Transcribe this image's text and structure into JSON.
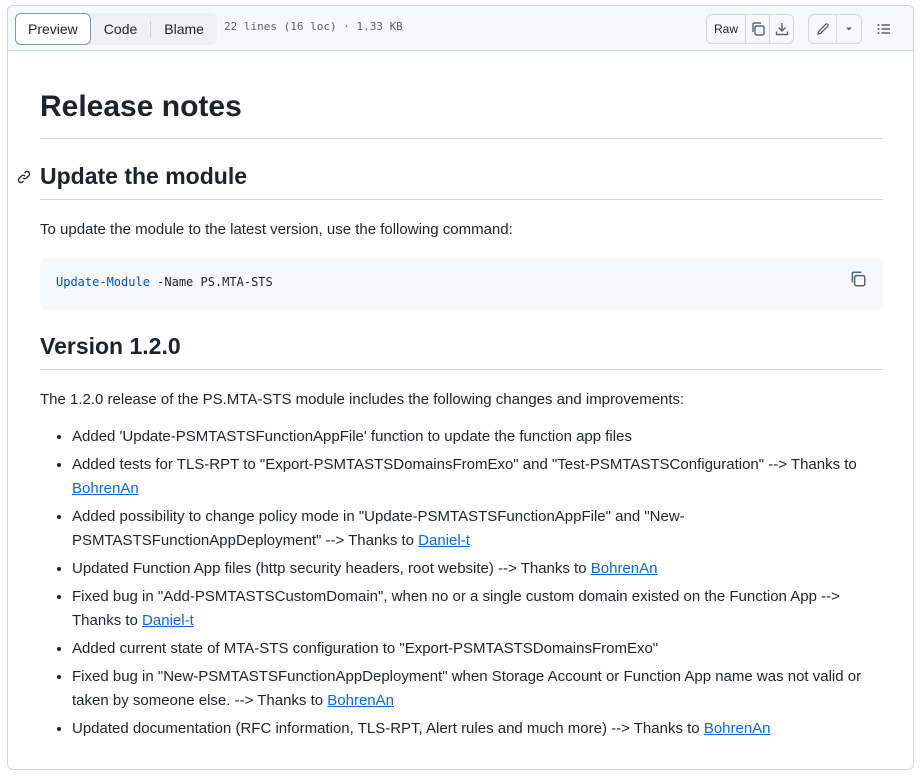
{
  "toolbar": {
    "tabs": [
      {
        "label": "Preview",
        "active": true
      },
      {
        "label": "Code",
        "active": false
      },
      {
        "label": "Blame",
        "active": false
      }
    ],
    "file_meta": "22 lines (16 loc) · 1.33 KB",
    "raw_label": "Raw",
    "icons": [
      "copy-icon",
      "download-icon",
      "pencil-icon",
      "triangle-down-icon",
      "list-icon"
    ]
  },
  "doc": {
    "title": "Release notes",
    "section1": {
      "heading": "Update the module",
      "intro": "To update the module to the latest version, use the following command:",
      "code_cmd": "Update-Module",
      "code_args": " -Name PS.MTA-STS"
    },
    "section2": {
      "heading": "Version 1.2.0",
      "intro": "The 1.2.0 release of the PS.MTA-STS module includes the following changes and improvements:",
      "items": [
        {
          "text": "Added 'Update-PSMTASTSFunctionAppFile' function to update the function app files",
          "link": ""
        },
        {
          "text": "Added tests for TLS-RPT to \"Export-PSMTASTSDomainsFromExo\" and \"Test-PSMTASTSConfiguration\" --> Thanks to ",
          "link": "BohrenAn"
        },
        {
          "text": "Added possibility to change policy mode in \"Update-PSMTASTSFunctionAppFile\" and \"New-PSMTASTSFunctionAppDeployment\" --> Thanks to ",
          "link": "Daniel-t"
        },
        {
          "text": "Updated Function App files (http security headers, root website) --> Thanks to ",
          "link": "BohrenAn"
        },
        {
          "text": "Fixed bug in \"Add-PSMTASTSCustomDomain\", when no or a single custom domain existed on the Function App --> Thanks to ",
          "link": "Daniel-t"
        },
        {
          "text": "Added current state of MTA-STS configuration to \"Export-PSMTASTSDomainsFromExo\"",
          "link": ""
        },
        {
          "text": "Fixed bug in \"New-PSMTASTSFunctionAppDeployment\" when Storage Account or Function App name was not valid or taken by someone else. --> Thanks to ",
          "link": "BohrenAn"
        },
        {
          "text": "Updated documentation (RFC information, TLS-RPT, Alert rules and much more) --> Thanks to ",
          "link": "BohrenAn"
        }
      ]
    }
  },
  "colors": {
    "link": "#0969da",
    "code_cmd": "#0550ae",
    "border": "#d1d9e0"
  }
}
